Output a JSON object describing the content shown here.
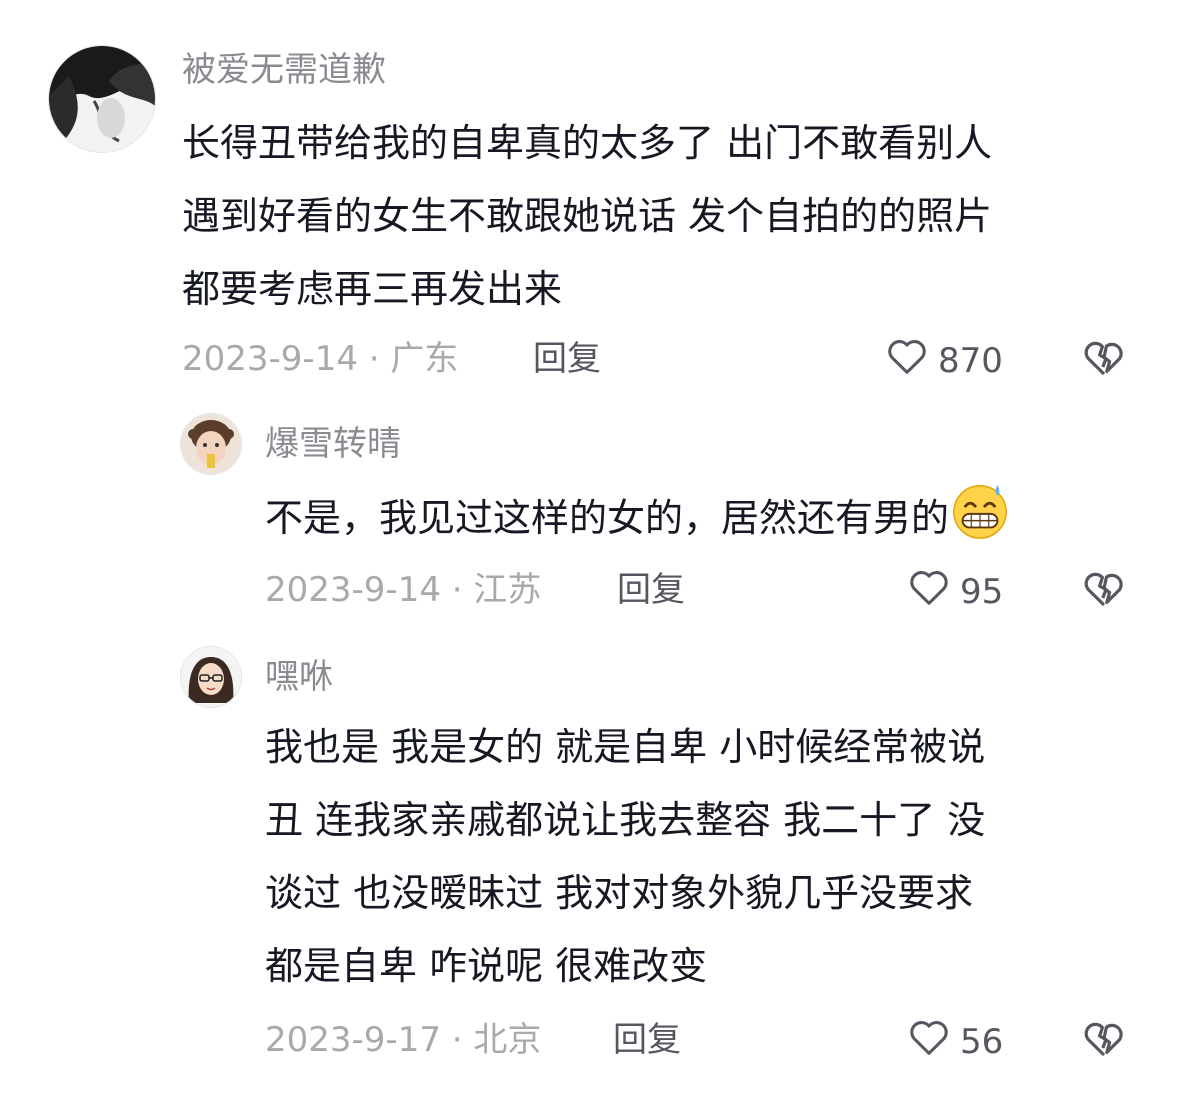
{
  "comments": [
    {
      "username": "被爱无需道歉",
      "text": "长得丑带给我的自卑真的太多了 出门不敢看别人\n遇到好看的女生不敢跟她说话 发个自拍的的照片\n都要考虑再三再发出来",
      "date": "2023-9-14",
      "location": "广东",
      "meta": "2023-9-14 · 广东",
      "reply_label": "回复",
      "likes": "870"
    },
    {
      "username": "爆雪转晴",
      "text": "不是，我见过这样的女的，居然还有男的",
      "emoji": "grinning-sweat-emoji",
      "date": "2023-9-14",
      "location": "江苏",
      "meta": "2023-9-14 · 江苏",
      "reply_label": "回复",
      "likes": "95"
    },
    {
      "username": "嘿咻",
      "text": "我也是 我是女的 就是自卑 小时候经常被说\n丑 连我家亲戚都说让我去整容 我二十了 没\n谈过 也没暧昧过 我对对象外貌几乎没要求\n都是自卑 咋说呢 很难改变",
      "date": "2023-9-17",
      "location": "北京",
      "meta": "2023-9-17 · 北京",
      "reply_label": "回复",
      "likes": "56"
    }
  ],
  "icons": {
    "like": "heart-outline-icon",
    "dislike": "broken-heart-icon"
  },
  "colors": {
    "text": "#161823",
    "username": "#8a8b91",
    "meta": "#a8a9ad",
    "action": "#555660"
  }
}
